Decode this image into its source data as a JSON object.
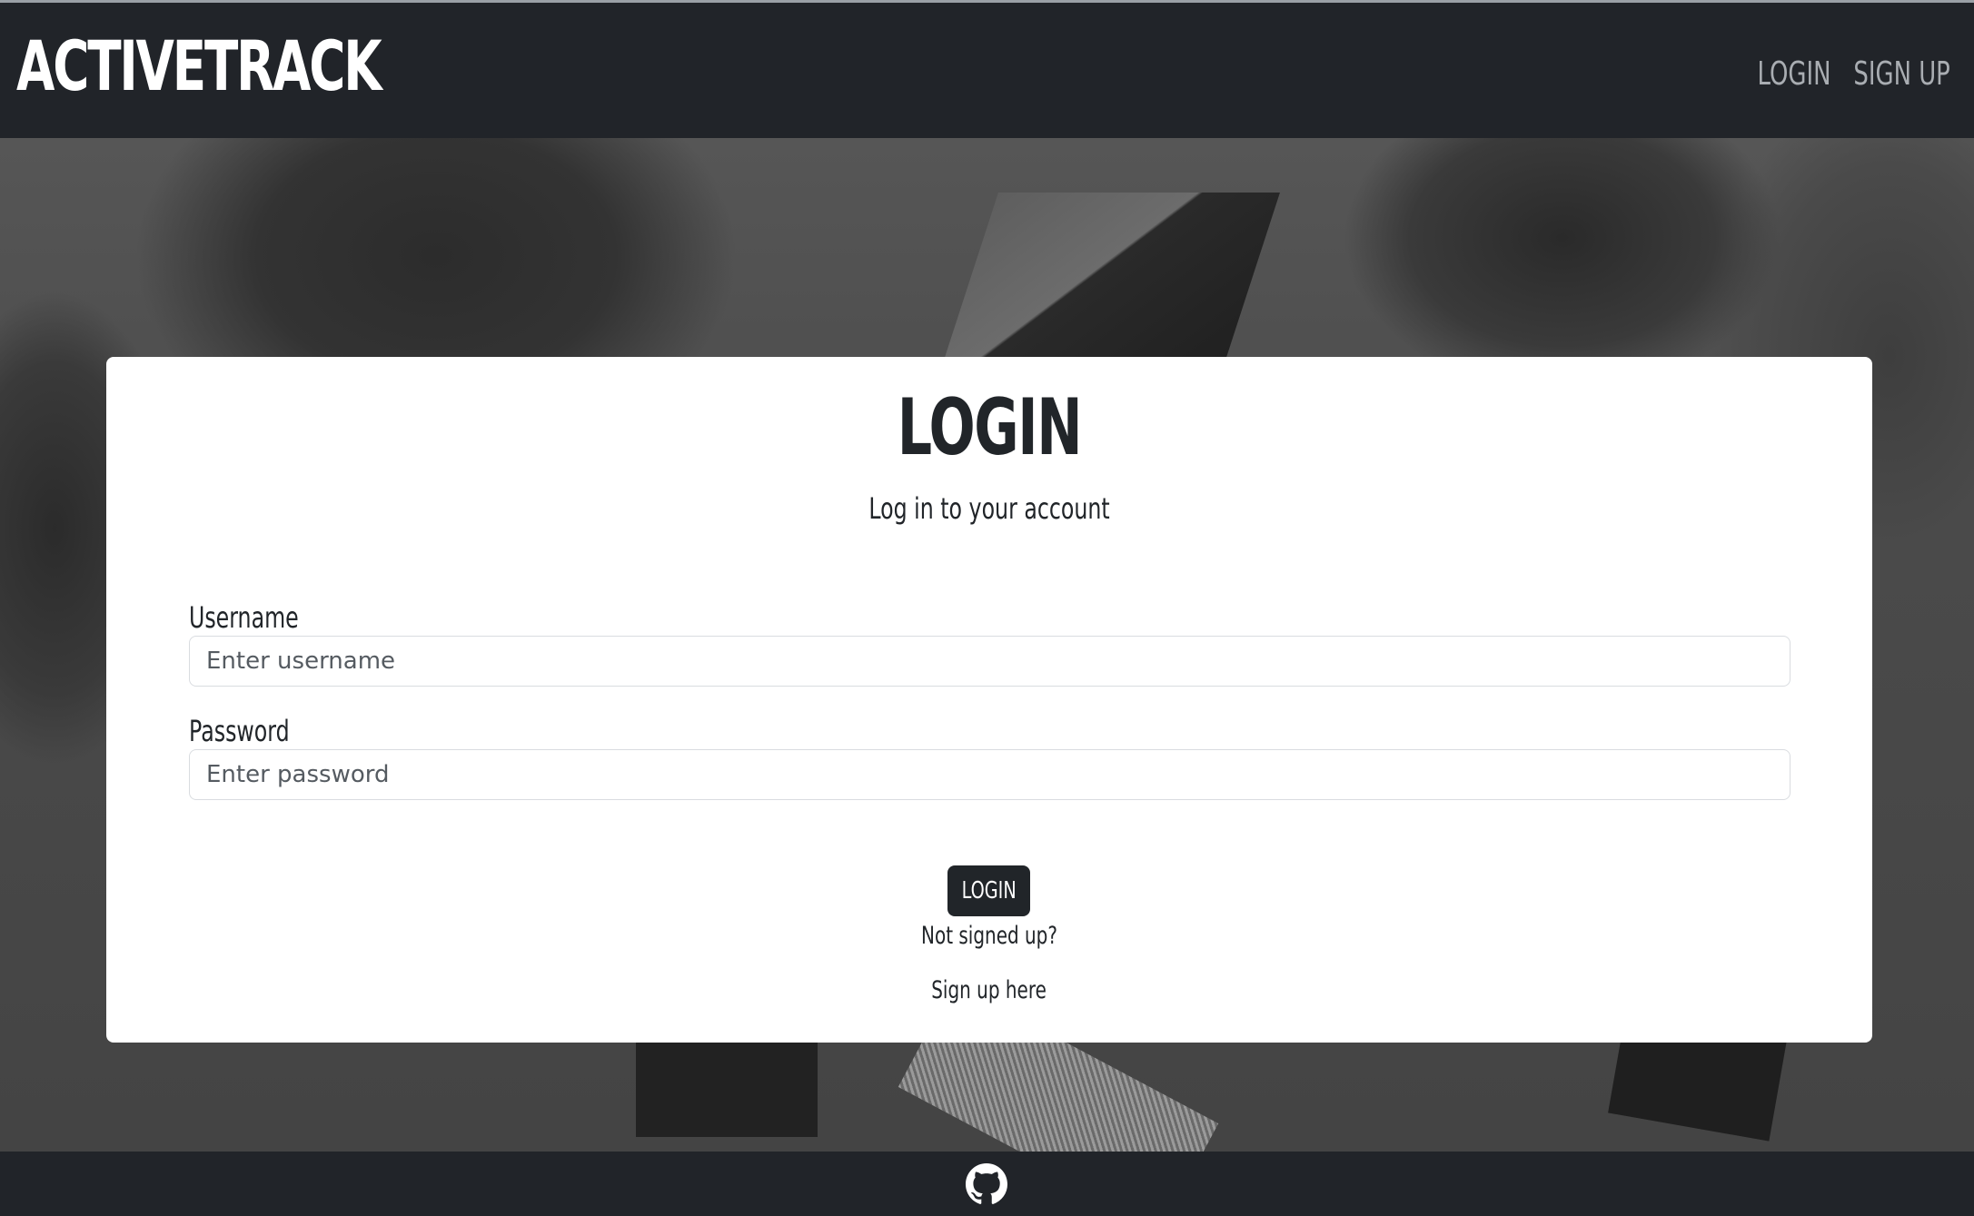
{
  "navbar": {
    "brand": "ACTIVETRACK",
    "links": [
      {
        "label": "LOGIN"
      },
      {
        "label": "SIGN UP"
      }
    ]
  },
  "card": {
    "title": "LOGIN",
    "subtitle": "Log in to your account",
    "username": {
      "label": "Username",
      "placeholder": "Enter username",
      "value": ""
    },
    "password": {
      "label": "Password",
      "placeholder": "Enter password",
      "value": ""
    },
    "submit_label": "LOGIN",
    "not_signed_text": "Not signed up?",
    "signup_link": "Sign up here"
  },
  "footer": {
    "icon": "github-icon"
  },
  "colors": {
    "navbar_bg": "#212429",
    "brand_text": "#ffffff",
    "nav_link": "#a9adb2",
    "card_bg": "#ffffff",
    "button_bg": "#212529",
    "footer_bg": "#212429"
  }
}
